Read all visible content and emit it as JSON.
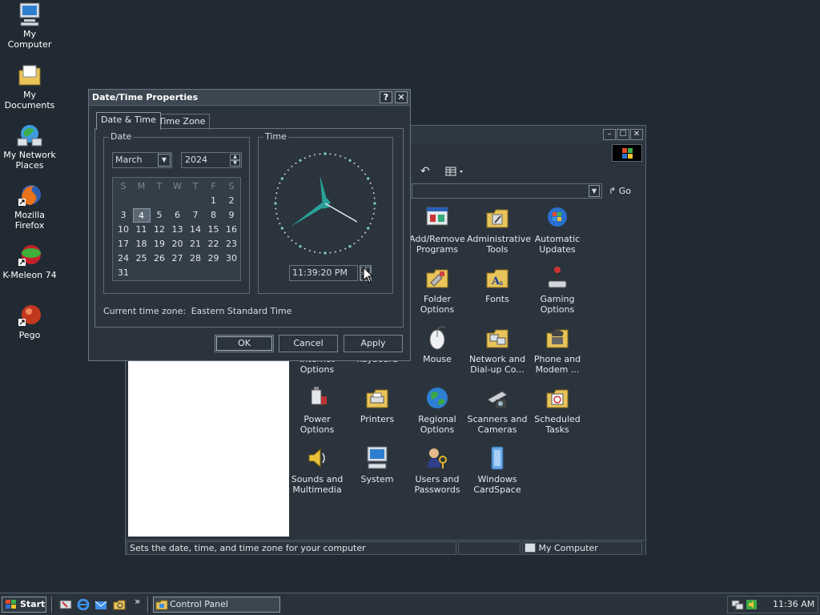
{
  "desktop": {
    "icons": [
      {
        "label": "My Computer"
      },
      {
        "label": "My Documents"
      },
      {
        "label": "My Network Places"
      },
      {
        "label": "Mozilla Firefox"
      },
      {
        "label": "K-Meleon 74"
      },
      {
        "label": "Pego"
      }
    ]
  },
  "control_panel": {
    "go_label": "Go",
    "items": [
      {
        "label": "Add/Remove Programs"
      },
      {
        "label": "Administrative Tools"
      },
      {
        "label": "Automatic Updates"
      },
      {
        "label": "Folder Options"
      },
      {
        "label": "Fonts"
      },
      {
        "label": "Gaming Options"
      },
      {
        "label": "Internet Options"
      },
      {
        "label": "Keyboard"
      },
      {
        "label": "Mouse"
      },
      {
        "label": "Network and Dial-up Co..."
      },
      {
        "label": "Phone and Modem ..."
      },
      {
        "label": "Power Options"
      },
      {
        "label": "Printers"
      },
      {
        "label": "Regional Options"
      },
      {
        "label": "Scanners and Cameras"
      },
      {
        "label": "Scheduled Tasks"
      },
      {
        "label": "Sounds and Multimedia"
      },
      {
        "label": "System"
      },
      {
        "label": "Users and Passwords"
      },
      {
        "label": "Windows CardSpace"
      }
    ],
    "status": {
      "text": "Sets the date, time, and time zone for your computer",
      "location": "My Computer"
    }
  },
  "dialog": {
    "title": "Date/Time Properties",
    "help_label": "?",
    "close_label": "✕",
    "tabs": [
      {
        "label": "Date & Time"
      },
      {
        "label": "Time Zone"
      }
    ],
    "date_group_label": "Date",
    "time_group_label": "Time",
    "month": "March",
    "year": "2024",
    "calendar": {
      "day_headers": [
        "S",
        "M",
        "T",
        "W",
        "T",
        "F",
        "S"
      ],
      "selected_day": "4",
      "weeks": [
        [
          "",
          "",
          "",
          "",
          "",
          "1",
          "2"
        ],
        [
          "3",
          "4",
          "5",
          "6",
          "7",
          "8",
          "9"
        ],
        [
          "10",
          "11",
          "12",
          "13",
          "14",
          "15",
          "16"
        ],
        [
          "17",
          "18",
          "19",
          "20",
          "21",
          "22",
          "23"
        ],
        [
          "24",
          "25",
          "26",
          "27",
          "28",
          "29",
          "30"
        ],
        [
          "31",
          "",
          "",
          "",
          "",
          "",
          ""
        ]
      ]
    },
    "time_value": "11:39:20 PM",
    "clock": {
      "hour": 11,
      "minute": 39,
      "second": 20
    },
    "timezone_label": "Current time zone:",
    "timezone_value": "Eastern Standard Time",
    "buttons": {
      "ok": "OK",
      "cancel": "Cancel",
      "apply": "Apply"
    }
  },
  "taskbar": {
    "start_label": "Start",
    "quick_launch_arrow": "»",
    "task_label": "Control Panel",
    "clock": "11:36 AM"
  },
  "colors": {
    "desktop": "#212a33",
    "window": "#2b343d",
    "clock_hand": "#2aa29a"
  }
}
